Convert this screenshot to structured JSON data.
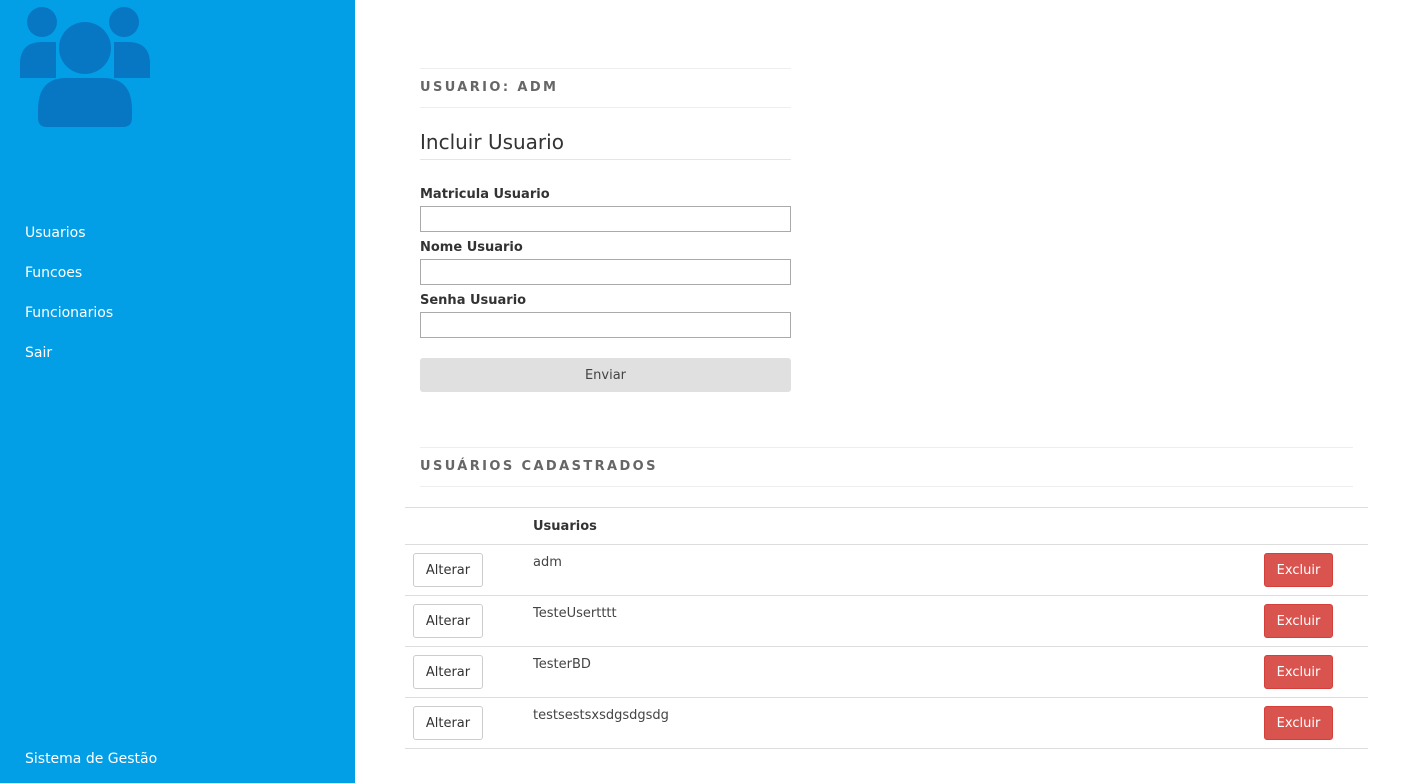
{
  "sidebar": {
    "logo_icon": "users-group-icon",
    "nav_items": [
      {
        "label": "Usuarios"
      },
      {
        "label": "Funcoes"
      },
      {
        "label": "Funcionarios"
      },
      {
        "label": "Sair"
      }
    ],
    "footer_label": "Sistema de Gestão"
  },
  "user_section": {
    "heading": "USUARIO: ADM"
  },
  "form": {
    "title": "Incluir Usuario",
    "fields": [
      {
        "label": "Matricula Usuario",
        "value": ""
      },
      {
        "label": "Nome Usuario",
        "value": ""
      },
      {
        "label": "Senha Usuario",
        "value": ""
      }
    ],
    "submit_label": "Enviar"
  },
  "users_section": {
    "heading": "USUÁRIOS CADASTRADOS",
    "table": {
      "columns": [
        "",
        "Usuarios",
        ""
      ],
      "rows": [
        {
          "alter_label": "Alterar",
          "name": "adm",
          "delete_label": "Excluir"
        },
        {
          "alter_label": "Alterar",
          "name": "TesteUsertttt",
          "delete_label": "Excluir"
        },
        {
          "alter_label": "Alterar",
          "name": "TesterBD",
          "delete_label": "Excluir"
        },
        {
          "alter_label": "Alterar",
          "name": "testsestsxsdgsdgsdg",
          "delete_label": "Excluir"
        }
      ]
    }
  },
  "colors": {
    "sidebar_bg": "#029fe7",
    "logo_fill": "#0877c3",
    "danger": "#d9534f",
    "submit_bg": "#e0e0e0"
  }
}
